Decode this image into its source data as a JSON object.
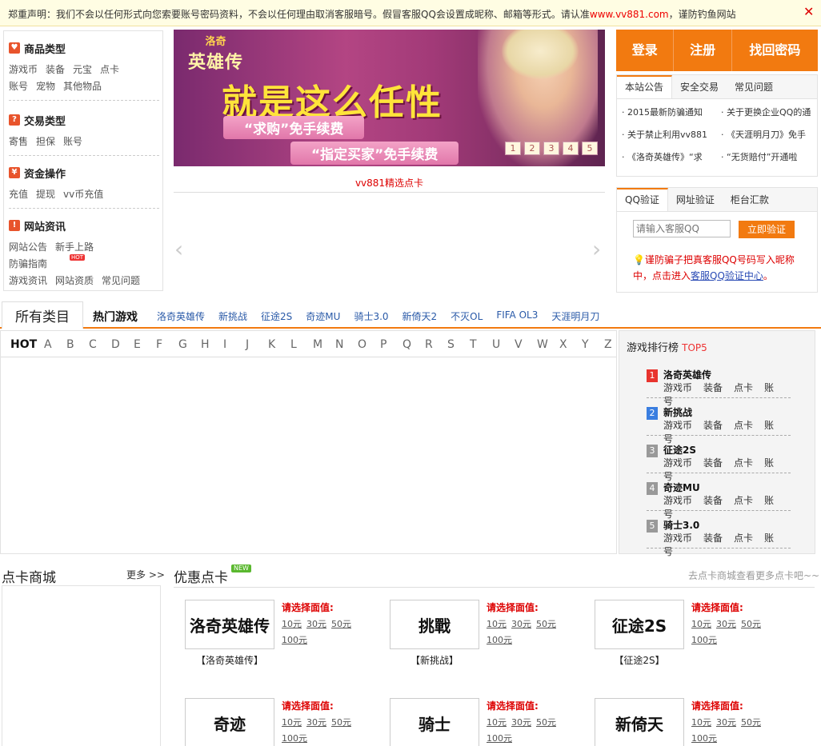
{
  "notice": {
    "text": "郑重声明：我们不会以任何形式向您索要账号密码资料，不会以任何理由取消客服暗号。假冒客服QQ会设置成昵称、邮箱等形式。请认准",
    "url": "www.vv881.com",
    "suffix": "，谨防钓鱼网站",
    "close": "✕"
  },
  "categories": [
    {
      "title": "商品类型",
      "icon": "heart-icon",
      "links": [
        "游戏币",
        "装备",
        "元宝",
        "点卡",
        "账号",
        "宠物",
        "其他物品"
      ]
    },
    {
      "title": "交易类型",
      "icon": "question-icon",
      "links": [
        "寄售",
        "担保",
        "账号"
      ]
    },
    {
      "title": "资金操作",
      "icon": "yen-icon",
      "links": [
        "充值",
        "提现",
        "vv币充值"
      ]
    },
    {
      "title": "网站资讯",
      "icon": "exclamation-icon",
      "links": [
        "网站公告",
        "新手上路",
        "防骗指南",
        "游戏资讯",
        "网站资质",
        "常见问题"
      ],
      "hot": "HOT"
    }
  ],
  "banner": {
    "logo_top": "洛奇",
    "logo_main": "英雄传",
    "headline": "就是这么任性",
    "pill1": "“求购”免手续费",
    "pill2": "“指定买家”免手续费",
    "pages": [
      "1",
      "2",
      "3",
      "4",
      "5"
    ]
  },
  "featured_title": "vv881精选点卡",
  "arrows": {
    "left": "‹",
    "right": "›"
  },
  "login": {
    "login": "登录",
    "register": "注册",
    "recover": "找回密码"
  },
  "notice_tabs": [
    "本站公告",
    "安全交易",
    "常见问题"
  ],
  "news": [
    "2015最新防骗通知",
    "关于更换企业QQ的通",
    "关于禁止利用vv881",
    "《天涯明月刀》免手",
    "《洛奇英雄传》“求",
    "“无货赔付”开通啦"
  ],
  "verify": {
    "tabs": [
      "QQ验证",
      "网址验证",
      "柜台汇款"
    ],
    "placeholder": "请输入客服QQ",
    "button": "立即验证",
    "tip": "谨防骗子把真客服QQ号码写入昵称中，点击进入",
    "tip_link": "客服QQ验证中心",
    "tip_end": "。",
    "bulb": "💡"
  },
  "catbar": {
    "all": "所有类目",
    "hot_label": "热门游戏",
    "hot_games": [
      "洛奇英雄传",
      "新挑战",
      "征途2S",
      "奇迹MU",
      "骑士3.0",
      "新倚天2",
      "不灭OL",
      "FIFA OL3",
      "天涯明月刀"
    ]
  },
  "alphabet": [
    "HOT",
    "A",
    "B",
    "C",
    "D",
    "E",
    "F",
    "G",
    "H",
    "I",
    "J",
    "K",
    "L",
    "M",
    "N",
    "O",
    "P",
    "Q",
    "R",
    "S",
    "T",
    "U",
    "V",
    "W",
    "X",
    "Y",
    "Z"
  ],
  "ranking": {
    "title": "游戏排行榜",
    "top": "TOP5",
    "items": [
      {
        "num": "1",
        "name": "洛奇英雄传",
        "color": "#e8342e"
      },
      {
        "num": "2",
        "name": "新挑战",
        "color": "#3a7ee0"
      },
      {
        "num": "3",
        "name": "征途2S",
        "color": "#999999"
      },
      {
        "num": "4",
        "name": "奇迹MU",
        "color": "#999999"
      },
      {
        "num": "5",
        "name": "骑士3.0",
        "color": "#999999"
      }
    ],
    "links": [
      "游戏币",
      "装备",
      "点卡",
      "账号"
    ]
  },
  "dianka": {
    "title": "点卡商城",
    "more": "更多 >>"
  },
  "youhui": {
    "title": "优惠点卡",
    "new": "NEW",
    "more": "去点卡商城查看更多点卡吧~~"
  },
  "cards": [
    {
      "name": "【洛奇英雄传】",
      "logo": "洛奇英雄传",
      "select": "请选择面值:",
      "values": [
        "10元",
        "30元",
        "50元",
        "100元"
      ]
    },
    {
      "name": "【新挑战】",
      "logo": "挑戰",
      "select": "请选择面值:",
      "values": [
        "10元",
        "30元",
        "50元",
        "100元"
      ]
    },
    {
      "name": "【征途2S】",
      "logo": "征途2S",
      "select": "请选择面值:",
      "values": [
        "10元",
        "30元",
        "50元",
        "100元"
      ]
    },
    {
      "name": "",
      "logo": "奇迹",
      "select": "请选择面值:",
      "values": [
        "10元",
        "30元",
        "50元",
        "100元"
      ]
    },
    {
      "name": "",
      "logo": "骑士",
      "select": "请选择面值:",
      "values": [
        "10元",
        "30元",
        "50元",
        "100元"
      ]
    },
    {
      "name": "",
      "logo": "新倚天",
      "select": "请选择面值:",
      "values": [
        "10元",
        "30元",
        "50元",
        "100元"
      ]
    }
  ]
}
